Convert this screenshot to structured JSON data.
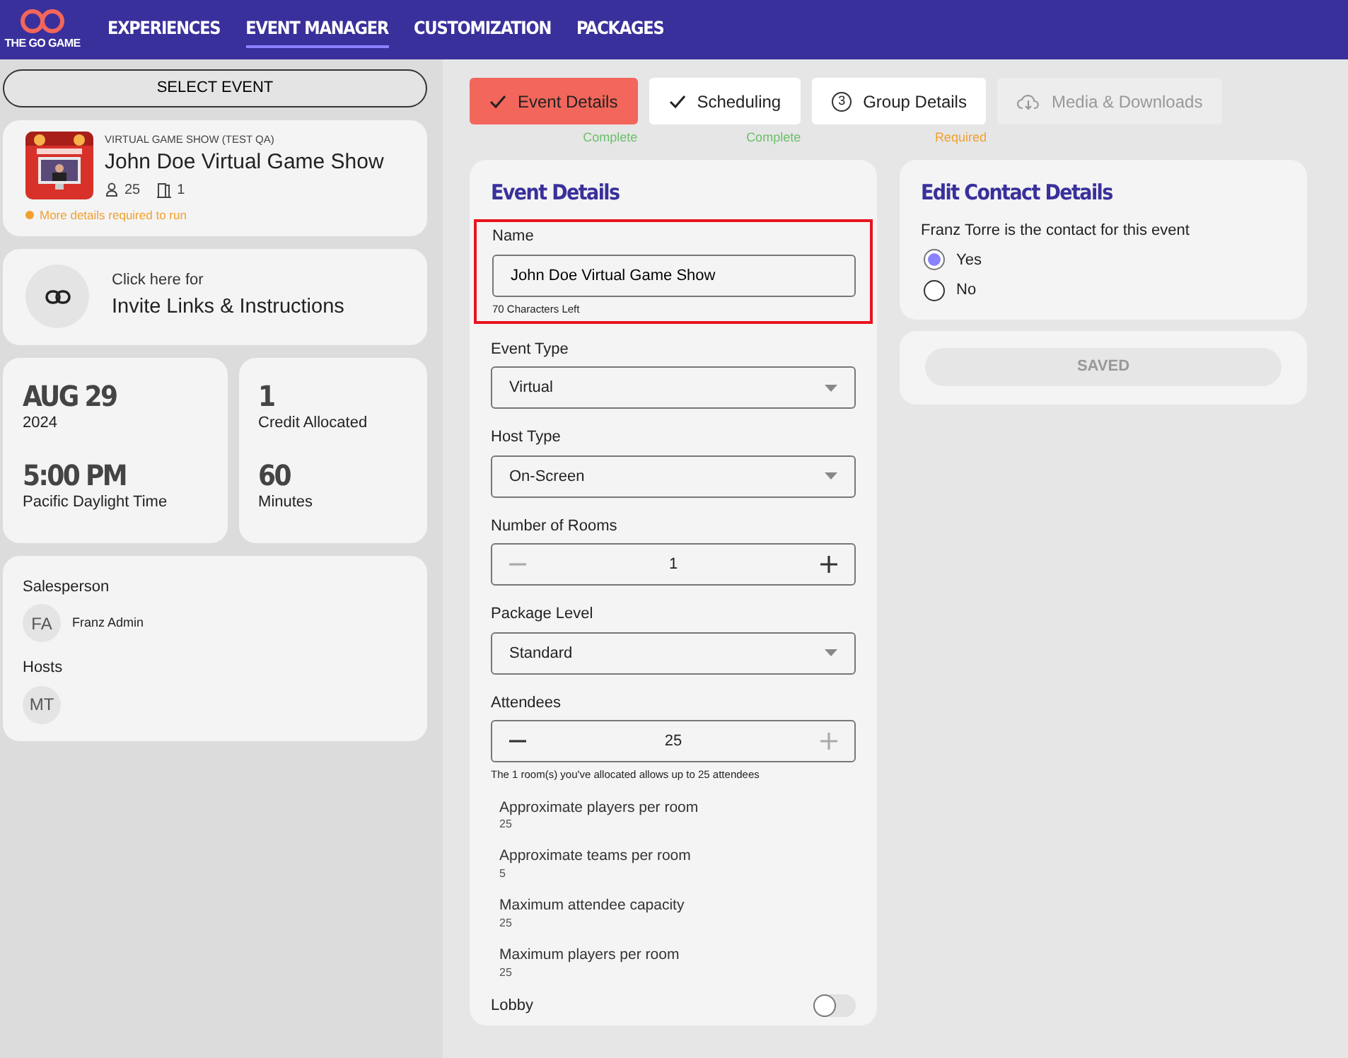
{
  "nav": {
    "logo": "THE GO GAME",
    "items": [
      {
        "label": "EXPERIENCES",
        "selected": false
      },
      {
        "label": "EVENT MANAGER",
        "selected": true
      },
      {
        "label": "CUSTOMIZATION",
        "selected": false
      },
      {
        "label": "PACKAGES",
        "selected": false
      }
    ]
  },
  "sidebar": {
    "select_button": "SELECT EVENT",
    "event": {
      "category": "VIRTUAL GAME SHOW (TEST QA)",
      "title": "John Doe Virtual Game Show",
      "attendees": "25",
      "rooms": "1",
      "warning": "More details required to run"
    },
    "invite": {
      "line1": "Click here for",
      "line2": "Invite Links & Instructions"
    },
    "stat_cards": [
      [
        {
          "value": "AUG 29",
          "label": "2024"
        },
        {
          "value": "5:00 PM",
          "label": "Pacific Daylight Time"
        }
      ],
      [
        {
          "value": "1",
          "label": "Credit Allocated"
        },
        {
          "value": "60",
          "label": "Minutes"
        }
      ]
    ],
    "people": [
      {
        "heading": "Salesperson",
        "people": [
          {
            "initials": "FA",
            "name": "Franz Admin"
          }
        ]
      },
      {
        "heading": "Hosts",
        "people": [
          {
            "initials": "MT"
          }
        ]
      }
    ]
  },
  "steps": [
    {
      "kind": "check",
      "label": "Event Details",
      "status": "Complete",
      "color": "#6cbf6c",
      "selected": true,
      "disabled": false
    },
    {
      "kind": "check",
      "label": "Scheduling",
      "status": "Complete",
      "color": "#6cbf6c",
      "selected": false,
      "disabled": false
    },
    {
      "kind": "number",
      "number": "3",
      "label": "Group Details",
      "status": "Required",
      "color": "#f0a030",
      "selected": false,
      "disabled": false
    },
    {
      "kind": "cloud",
      "label": "Media & Downloads",
      "selected": false,
      "disabled": true
    }
  ],
  "event_details": {
    "title": "Event Details",
    "fields": [
      {
        "kind": "text",
        "label": "Name",
        "value": "John Doe Virtual Game Show",
        "hint": "70 Characters Left",
        "highlighted": true
      },
      {
        "kind": "select",
        "label": "Event Type",
        "value": "Virtual"
      },
      {
        "kind": "select",
        "label": "Host Type",
        "value": "On-Screen"
      },
      {
        "kind": "stepper",
        "label": "Number of Rooms",
        "value": "1",
        "minus_disabled": true,
        "plus_disabled": false
      },
      {
        "kind": "select",
        "label": "Package Level",
        "value": "Standard"
      },
      {
        "kind": "stepper",
        "label": "Attendees",
        "value": "25",
        "minus_disabled": false,
        "plus_disabled": true,
        "hint": "The 1 room(s) you've allocated allows up to 25 attendees"
      }
    ],
    "stats": [
      {
        "label": "Approximate players per room",
        "value": "25"
      },
      {
        "label": "Approximate teams per room",
        "value": "5"
      },
      {
        "label": "Maximum attendee capacity",
        "value": "25"
      },
      {
        "label": "Maximum players per room",
        "value": "25"
      }
    ],
    "lobby": {
      "label": "Lobby",
      "on": false
    }
  },
  "contact": {
    "title": "Edit Contact Details",
    "question": "Franz Torre is the contact for this event",
    "options": [
      {
        "label": "Yes",
        "selected": true
      },
      {
        "label": "No",
        "selected": false
      }
    ]
  },
  "save_button": {
    "label": "SAVED",
    "disabled": true
  }
}
